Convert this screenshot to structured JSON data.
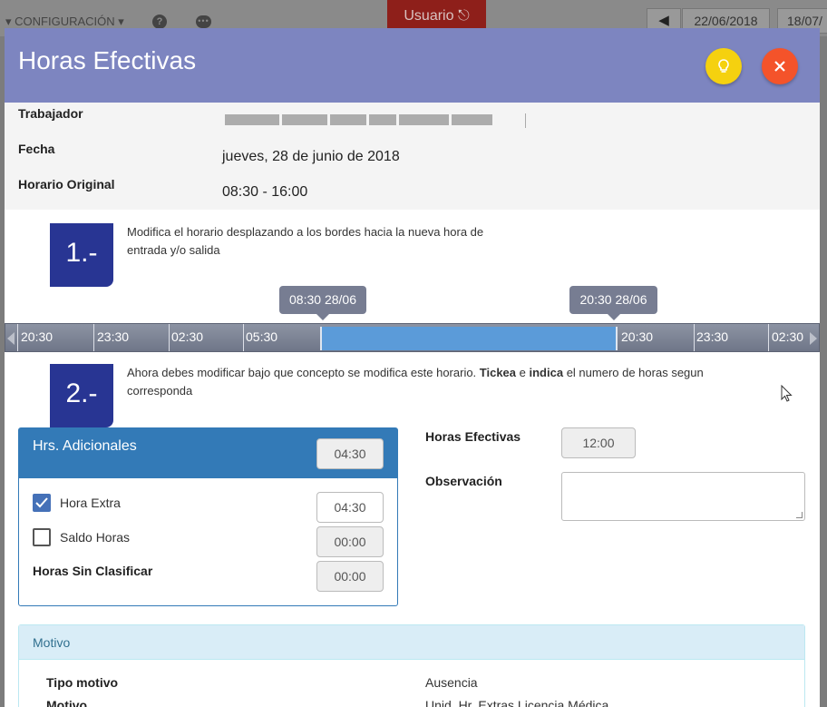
{
  "background": {
    "menu_label": "CONFIGURACIÓN",
    "help_icon": "?",
    "chat_icon": "•••",
    "user_button": "Usuario",
    "prev_arrow": "🡐",
    "date_current": "22/06/2018",
    "date_next": "18/07/"
  },
  "modal": {
    "title": "Horas Efectivas",
    "info": {
      "worker_label": "Trabajador",
      "date_label": "Fecha",
      "date_value": "jueves, 28 de junio de 2018",
      "schedule_label": "Horario Original",
      "schedule_value": "08:30 - 16:00"
    },
    "step1": {
      "number": "1.-",
      "text": "Modifica el horario desplazando a los bordes hacia la nueva hora de entrada y/o salida"
    },
    "timeline": {
      "start_tooltip": "08:30 28/06",
      "end_tooltip": "20:30 28/06",
      "ticks": [
        "20:30",
        "23:30",
        "02:30",
        "05:30",
        "20:30",
        "23:30",
        "02:30"
      ]
    },
    "step2": {
      "number": "2.-",
      "text_a": "Ahora debes modificar bajo que concepto se modifica este horario. ",
      "bold_1": "Tickea",
      "text_b": " e ",
      "bold_2": "indica",
      "text_c": " el numero de horas segun corresponda"
    },
    "additional": {
      "title": "Hrs. Adicionales",
      "total": "04:30",
      "overtime_label": "Hora Extra",
      "overtime_value": "04:30",
      "overtime_checked": true,
      "balance_label": "Saldo Horas",
      "balance_value": "00:00",
      "balance_checked": false,
      "unclassified_label": "Horas Sin Clasificar",
      "unclassified_value": "00:00"
    },
    "effective_hours_label": "Horas Efectivas",
    "effective_hours_value": "12:00",
    "observation_label": "Observación",
    "observation_value": "",
    "reason": {
      "title": "Motivo",
      "type_label": "Tipo motivo",
      "type_value": "Ausencia",
      "reason_label": "Motivo",
      "reason_value": "Unid. Hr. Extras Licencia Médica"
    }
  },
  "colors": {
    "header": "#7d85c0",
    "step_box": "#283593",
    "panel": "#337ab7",
    "bulb_button": "#f5d10f",
    "close_button": "#f4532a",
    "timeline_selection": "#5b9bd9"
  }
}
